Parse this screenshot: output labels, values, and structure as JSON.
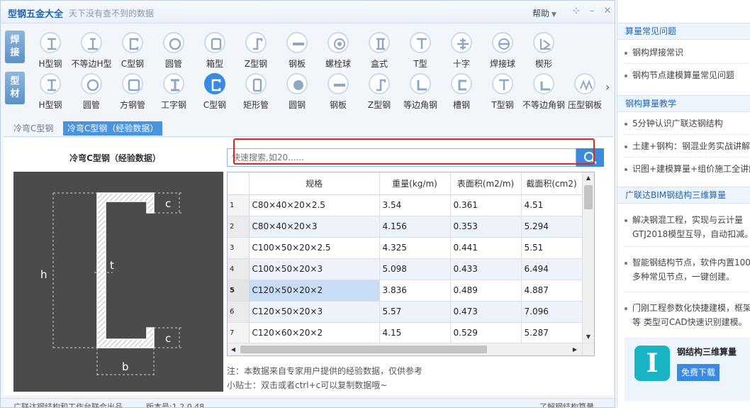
{
  "window": {
    "title": "型钢五金大全",
    "slogan": "天下没有查不到的数据",
    "help_label": "帮助",
    "pin_icon": "pin-icon",
    "minimize_icon": "minimize-icon",
    "close_icon": "close-icon"
  },
  "categories": {
    "weld": {
      "char1": "焊",
      "char2": "接"
    },
    "profile": {
      "char1": "型",
      "char2": "材"
    }
  },
  "weld_tools": [
    {
      "label": "H型钢",
      "icon": "h-beam-icon"
    },
    {
      "label": "不等边H型",
      "icon": "unequal-h-icon"
    },
    {
      "label": "C型钢",
      "icon": "c-channel-icon"
    },
    {
      "label": "圆管",
      "icon": "round-pipe-icon"
    },
    {
      "label": "箱型",
      "icon": "box-section-icon"
    },
    {
      "label": "Z型钢",
      "icon": "z-section-icon"
    },
    {
      "label": "钢板",
      "icon": "steel-plate-icon"
    },
    {
      "label": "螺栓球",
      "icon": "bolt-ball-icon"
    },
    {
      "label": "盒式",
      "icon": "box-type-icon"
    },
    {
      "label": "T型",
      "icon": "t-section-icon"
    },
    {
      "label": "十字",
      "icon": "cross-section-icon"
    },
    {
      "label": "焊接球",
      "icon": "welded-ball-icon"
    },
    {
      "label": "楔形",
      "icon": "wedge-icon"
    }
  ],
  "profile_tools": [
    {
      "label": "H型钢",
      "icon": "h-beam-icon"
    },
    {
      "label": "圆管",
      "icon": "round-pipe-icon"
    },
    {
      "label": "方钢管",
      "icon": "square-pipe-icon"
    },
    {
      "label": "工字钢",
      "icon": "i-beam-icon"
    },
    {
      "label": "C型钢",
      "icon": "c-channel-icon",
      "selected": true
    },
    {
      "label": "矩形管",
      "icon": "rect-pipe-icon"
    },
    {
      "label": "圆钢",
      "icon": "round-bar-icon"
    },
    {
      "label": "钢板",
      "icon": "steel-plate-icon"
    },
    {
      "label": "Z型钢",
      "icon": "z-section-icon"
    },
    {
      "label": "等边角钢",
      "icon": "equal-angle-icon"
    },
    {
      "label": "槽钢",
      "icon": "channel-icon"
    },
    {
      "label": "T型钢",
      "icon": "t-section-icon"
    },
    {
      "label": "不等边角钢",
      "icon": "unequal-angle-icon"
    },
    {
      "label": "压型钢板",
      "icon": "profiled-sheet-icon"
    }
  ],
  "subtabs": [
    {
      "label": "冷弯C型钢",
      "active": false
    },
    {
      "label": "冷弯C型钢（经验数据）",
      "active": true
    }
  ],
  "diagram": {
    "title": "冷弯C型钢（经验数据）",
    "labels": {
      "h": "h",
      "t": "t",
      "b": "b",
      "c_top": "c",
      "c_bottom": "c"
    }
  },
  "search": {
    "placeholder": "快速搜索,如20......",
    "icon": "search-icon"
  },
  "table": {
    "columns": [
      "规格",
      "重量(kg/m)",
      "表面积(m2/m)",
      "截面积(cm2)"
    ],
    "selected_row": 5,
    "rows": [
      {
        "no": "1",
        "spec": "C80×40×20×2.5",
        "weight": "3.54",
        "surface": "0.361",
        "section": "4.51"
      },
      {
        "no": "2",
        "spec": "C80×40×20×3",
        "weight": "4.156",
        "surface": "0.353",
        "section": "5.294"
      },
      {
        "no": "3",
        "spec": "C100×50×20×2.5",
        "weight": "4.325",
        "surface": "0.441",
        "section": "5.51"
      },
      {
        "no": "4",
        "spec": "C100×50×20×3",
        "weight": "5.098",
        "surface": "0.433",
        "section": "6.494"
      },
      {
        "no": "5",
        "spec": "C120×50×20×2",
        "weight": "3.836",
        "surface": "0.489",
        "section": "4.887"
      },
      {
        "no": "6",
        "spec": "C120×50×20×3",
        "weight": "5.57",
        "surface": "0.473",
        "section": "7.096"
      },
      {
        "no": "7",
        "spec": "C120×60×20×2",
        "weight": "4.15",
        "surface": "0.529",
        "section": "5.287"
      }
    ]
  },
  "notes": {
    "note1": "注：本数据来自专家用户提供的经验数据，仅供参考",
    "note2": "小贴士：双击或者ctrl+c可以复制数据哦~"
  },
  "status": {
    "left": "广联达钢结构和工作台联合出品",
    "version": "版本号:1.2.0.48",
    "right": "了解钢结构算量"
  },
  "sidebar": {
    "sections": [
      {
        "title": "算量常见问题",
        "items": [
          [
            "钢构焊接常识"
          ],
          [
            "钢构节点建模算量常见问题"
          ]
        ]
      },
      {
        "title": "钢构算量教学",
        "items": [
          [
            "5分钟认识广联达钢结构"
          ],
          [
            "土建+钢构：钢混业务实战讲解"
          ],
          [
            "识图+建模算量+组价施工全讲解"
          ]
        ]
      },
      {
        "title": "广联达BIM钢结构三维算量",
        "items": [
          [
            "解决钢混工程，实现与云计量",
            "GTJ2018模型互导，自动扣减。"
          ],
          [
            "智能钢结构节点，软件内置1000",
            "多种常见节点，一键创建。"
          ],
          [
            "门刚工程参数化快捷建模，框架",
            "等 类型可CAD快速识别建模。"
          ]
        ]
      }
    ],
    "promo": {
      "title": "钢结构三维算量",
      "button": "免费下载",
      "logo_char": "I"
    }
  }
}
